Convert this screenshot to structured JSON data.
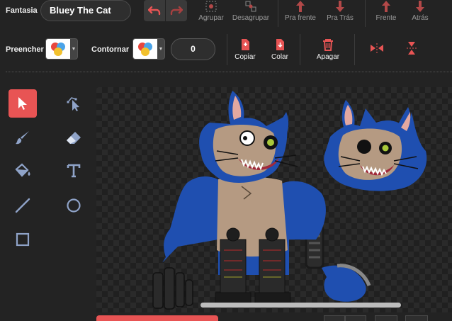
{
  "costume": {
    "label": "Fantasia",
    "name": "Bluey The Cat"
  },
  "toolbar": {
    "group": "Agrupar",
    "ungroup": "Desagrupar",
    "forward": "Pra frente",
    "backward": "Pra Trás",
    "front": "Frente",
    "back": "Atrás",
    "fill_label": "Preencher",
    "outline_label": "Contornar",
    "outline_width": "0",
    "copy": "Copiar",
    "paste": "Colar",
    "delete": "Apagar"
  },
  "colors": {
    "accent": "#e85454",
    "cat_blue": "#1f4fb0",
    "cat_skin": "#b59a82"
  }
}
